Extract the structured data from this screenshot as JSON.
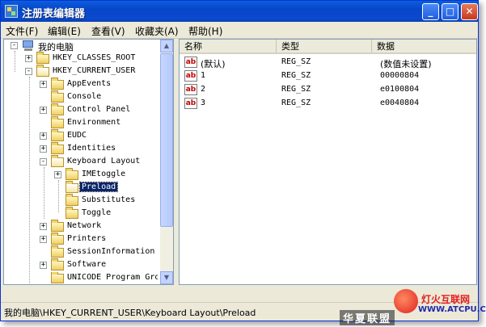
{
  "window": {
    "title": "注册表编辑器",
    "minimize_glyph": "_",
    "maximize_glyph": "□",
    "close_glyph": "✕"
  },
  "menu": [
    "文件(F)",
    "编辑(E)",
    "查看(V)",
    "收藏夹(A)",
    "帮助(H)"
  ],
  "tree": {
    "root": "我的电脑",
    "items": [
      {
        "label": "HKEY_CLASSES_ROOT",
        "expander": "+"
      },
      {
        "label": "HKEY_CURRENT_USER",
        "expander": "-"
      },
      {
        "label": "AppEvents",
        "expander": "+"
      },
      {
        "label": "Console",
        "expander": ""
      },
      {
        "label": "Control Panel",
        "expander": "+"
      },
      {
        "label": "Environment",
        "expander": ""
      },
      {
        "label": "EUDC",
        "expander": "+"
      },
      {
        "label": "Identities",
        "expander": "+"
      },
      {
        "label": "Keyboard Layout",
        "expander": "-"
      },
      {
        "label": "IMEtoggle",
        "expander": "+"
      },
      {
        "label": "Preload",
        "expander": ""
      },
      {
        "label": "Substitutes",
        "expander": ""
      },
      {
        "label": "Toggle",
        "expander": ""
      },
      {
        "label": "Network",
        "expander": "+"
      },
      {
        "label": "Printers",
        "expander": "+"
      },
      {
        "label": "SessionInformation",
        "expander": ""
      },
      {
        "label": "Software",
        "expander": "+"
      },
      {
        "label": "UNICODE Program Gro",
        "expander": ""
      }
    ]
  },
  "list": {
    "columns": [
      "名称",
      "类型",
      "数据"
    ],
    "rows": [
      {
        "icon": "ab",
        "name": "(默认)",
        "type": "REG_SZ",
        "data": "(数值未设置)"
      },
      {
        "icon": "ab",
        "name": "1",
        "type": "REG_SZ",
        "data": "00000804"
      },
      {
        "icon": "ab",
        "name": "2",
        "type": "REG_SZ",
        "data": "e0100804"
      },
      {
        "icon": "ab",
        "name": "3",
        "type": "REG_SZ",
        "data": "e0040804"
      }
    ]
  },
  "status": "我的电脑\\HKEY_CURRENT_USER\\Keyboard Layout\\Preload",
  "watermark": {
    "left": "华夏联盟",
    "site_name": "灯火互联网",
    "site_url": "WWW.ATCPU.COM"
  },
  "colors": {
    "titlebar": "#0846c8",
    "selection": "#0a246a",
    "ab_red": "#c00000"
  }
}
